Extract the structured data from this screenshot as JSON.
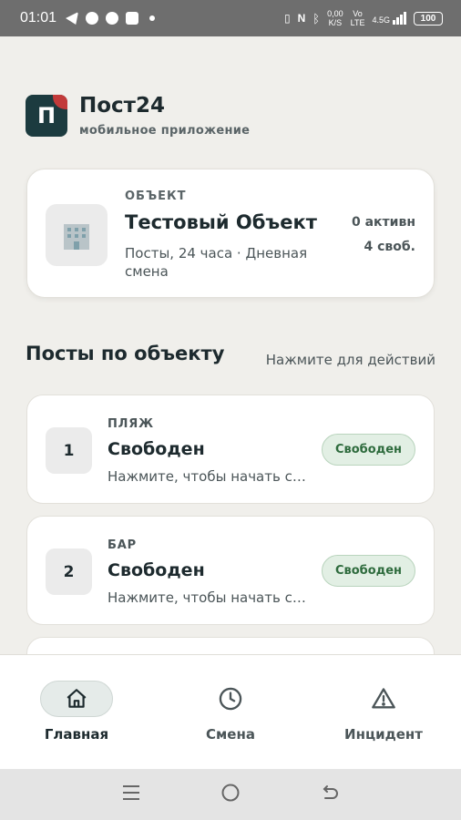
{
  "status_bar": {
    "time": "01:01",
    "speed_top": "0,00",
    "speed_bottom": "K/S",
    "network": "4.5G",
    "volte_top": "Vo",
    "volte_bottom": "LTE",
    "battery": "100"
  },
  "app": {
    "logo_letter": "П",
    "name": "Пост24",
    "subtitle": "мобильное приложение"
  },
  "object": {
    "label": "ОБЪЕКТ",
    "name": "Тестовый Объект",
    "description": "Посты, 24 часа · Дневная смена",
    "active": "0 активн",
    "free": "4 своб."
  },
  "section": {
    "title": "Посты по объекту",
    "hint": "Нажмите для действий"
  },
  "posts": [
    {
      "number": "1",
      "zone": "ПЛЯЖ",
      "status": "Свободен",
      "hint": "Нажмите, чтобы начать с…",
      "badge": "Свободен"
    },
    {
      "number": "2",
      "zone": "БАР",
      "status": "Свободен",
      "hint": "Нажмите, чтобы начать с…",
      "badge": "Свободен"
    }
  ],
  "nav": {
    "home": "Главная",
    "shift": "Смена",
    "incident": "Инцидент"
  },
  "colors": {
    "accent": "#1c3b3f",
    "logo_corner": "#c23a3a",
    "badge_bg": "#e2efe4",
    "badge_text": "#2e6b3d",
    "background": "#f0efeb"
  }
}
